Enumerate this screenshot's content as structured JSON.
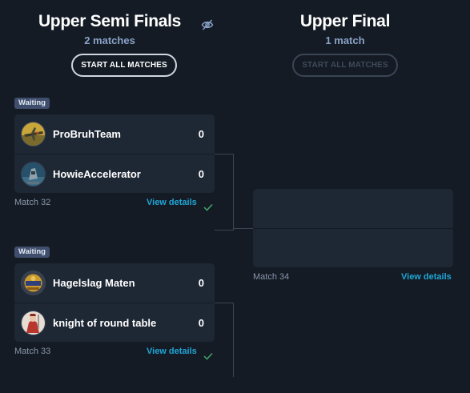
{
  "columns": [
    {
      "title": "Upper Semi Finals",
      "subtitle": "2 matches",
      "button": "START ALL MATCHES"
    },
    {
      "title": "Upper Final",
      "subtitle": "1 match",
      "button": "START ALL MATCHES"
    }
  ],
  "icons": {
    "hide_toggle": "eye-off-icon",
    "check": "check-icon"
  },
  "matches": [
    {
      "status": "Waiting",
      "label": "Match 32",
      "link": "View details",
      "teams": [
        {
          "name": "ProBruhTeam",
          "score": "0",
          "avatar": "team-avatar-plane"
        },
        {
          "name": "HowieAccelerator",
          "score": "0",
          "avatar": "team-avatar-mech"
        }
      ]
    },
    {
      "status": "Waiting",
      "label": "Match 33",
      "link": "View details",
      "teams": [
        {
          "name": "Hagelslag Maten",
          "score": "0",
          "avatar": "team-avatar-crest"
        },
        {
          "name": "knight of round table",
          "score": "0",
          "avatar": "team-avatar-knight"
        }
      ]
    },
    {
      "label": "Match 34",
      "link": "View details",
      "teams": []
    }
  ],
  "colors": {
    "background": "#141b24",
    "card": "#1e2734",
    "link": "#1fa6d6",
    "badge": "#3f4e6d",
    "subtitle": "#8aa2c8",
    "check": "#3fa66a"
  }
}
